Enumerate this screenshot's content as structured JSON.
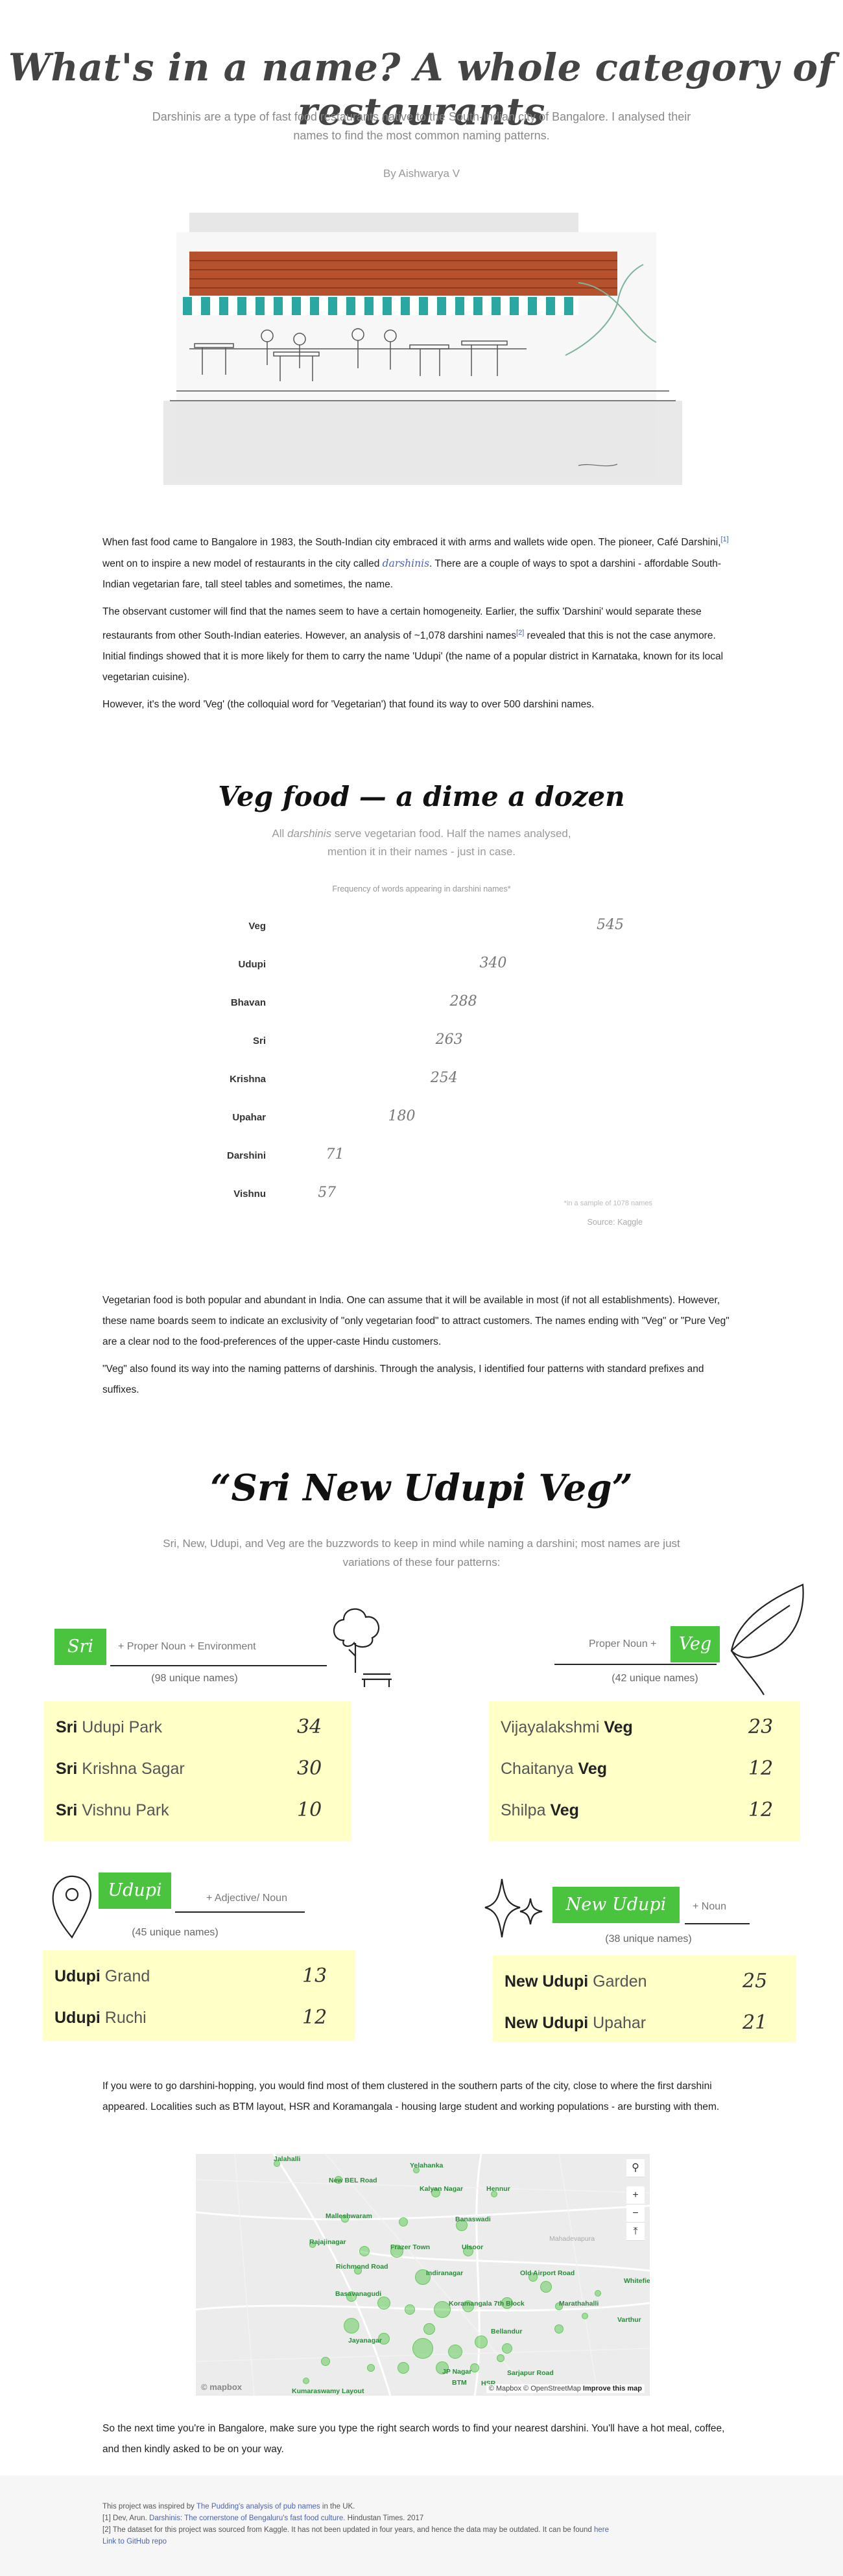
{
  "header": {
    "title": "What's in a name? A whole category of restaurants",
    "subtitle": "Darshinis are a type of fast food restaurants native to the South-Indian city of Bangalore. I analysed their names to find the most common naming patterns.",
    "byline": "By Aishwarya V"
  },
  "intro": {
    "p1_a": "When fast food came to Bangalore in 1983, the South-Indian city embraced it with arms and wallets wide open. The pioneer, Café Darshini,",
    "p1_ref": "[1]",
    "p1_b": " went on to inspire a new model of restaurants in the city called ",
    "p1_link": "darshinis",
    "p1_c": ". There are a couple of ways to spot a darshini - affordable South-Indian vegetarian fare, tall steel tables and sometimes, the name.",
    "p2_a": "The observant customer will find that the names seem to have a certain homogeneity. Earlier, the suffix 'Darshini' would separate these restaurants from other South-Indian eateries. However, an analysis of ~1,078 darshini names",
    "p2_ref": "[2]",
    "p2_b": " revealed that this is not the case anymore. Initial findings showed that it is more likely for them to carry the name 'Udupi' (the name of a popular district in Karnataka, known for its local vegetarian cuisine).",
    "p3": "However, it's the word 'Veg' (the colloquial word for 'Vegetarian') that found its way to over 500 darshini names."
  },
  "section1": {
    "heading": "Veg food — a dime a dozen",
    "sub_a": "All ",
    "sub_em": "darshinis",
    "sub_b": " serve vegetarian food. Half the names analysed, mention it in their names - just in case."
  },
  "chart_data": {
    "type": "bar",
    "title": "Frequency of words appearing in darshini names*",
    "categories": [
      "Veg",
      "Udupi",
      "Bhavan",
      "Sri",
      "Krishna",
      "Upahar",
      "Darshini",
      "Vishnu"
    ],
    "values": [
      545,
      340,
      288,
      263,
      254,
      180,
      71,
      57
    ],
    "note": "*in a sample of 1078 names",
    "source": "Source: Kaggle"
  },
  "middle": {
    "p1": "Vegetarian food is both popular and abundant in India. One can assume that it will be available in most (if not all establishments). However, these name boards seem to indicate an exclusivity of \"only vegetarian food\" to attract customers. The names ending with \"Veg\" or \"Pure Veg\" are a clear nod to the food-preferences of the upper-caste Hindu customers.",
    "p2": "\"Veg\" also found its way into the naming patterns of darshinis. Through the analysis, I identified four patterns with standard prefixes and suffixes."
  },
  "section2": {
    "heading": "“Sri New Udupi Veg”",
    "sub": "Sri, New, Udupi, and Veg are the buzzwords to keep in mind while naming a darshini; most names are just variations of these four patterns:"
  },
  "patterns": {
    "sri": {
      "tag": "Sri",
      "text": "+ Proper Noun + Environment",
      "count": "(98 unique names)",
      "examples": [
        {
          "prefix": "Sri",
          "rest": " Udupi Park",
          "num": "34"
        },
        {
          "prefix": "Sri",
          "rest": " Krishna Sagar",
          "num": "30"
        },
        {
          "prefix": "Sri",
          "rest": " Vishnu Park",
          "num": "10"
        }
      ]
    },
    "veg": {
      "tag": "Veg",
      "text": "Proper Noun +",
      "count": "(42 unique names)",
      "examples": [
        {
          "rest": "Vijayalakshmi ",
          "suffix": "Veg",
          "num": "23"
        },
        {
          "rest": "Chaitanya ",
          "suffix": "Veg",
          "num": "12"
        },
        {
          "rest": "Shilpa ",
          "suffix": "Veg",
          "num": "12"
        }
      ]
    },
    "udupi": {
      "tag": "Udupi",
      "text": "+ Adjective/ Noun",
      "count": "(45 unique names)",
      "examples": [
        {
          "prefix": "Udupi",
          "rest": " Grand",
          "num": "13"
        },
        {
          "prefix": "Udupi",
          "rest": " Ruchi",
          "num": "12"
        }
      ]
    },
    "new_udupi": {
      "tag": "New Udupi",
      "text": "+ Noun",
      "count": "(38 unique names)",
      "examples": [
        {
          "prefix": "New Udupi",
          "rest": " Garden",
          "num": "25"
        },
        {
          "prefix": "New Udupi",
          "rest": " Upahar",
          "num": "21"
        }
      ]
    }
  },
  "hopping": {
    "p1": "If you were to go darshini-hopping, you would find most of them clustered in the southern parts of the city, close to where the first darshini appeared. Localities such as BTM layout, HSR and Koramangala - housing large student and working populations - are bursting with them."
  },
  "map": {
    "places": [
      "Jalahalli",
      "Yelahanka",
      "New BEL Road",
      "Kalyan Nagar",
      "Hennur",
      "Malleshwaram",
      "Banaswadi",
      "Rajajinagar",
      "Frazer Town",
      "Ulsoor",
      "Richmond Road",
      "Indiranagar",
      "Old Airport Road",
      "Whitefield",
      "Basavanagudi",
      "Koramangala 7th Block",
      "Marathahalli",
      "Jayanagar",
      "Bellandur",
      "Varthur",
      "JP Nagar",
      "BTM",
      "HSR",
      "Sarjapur Road",
      "Kumaraswamy Layout",
      "Mahadevapura"
    ],
    "credit_a": "© Mapbox © OpenStreetMap",
    "credit_b": "Improve this map",
    "logo": "© mapbox",
    "zoom_in": "+",
    "zoom_out": "−",
    "search": "⚲",
    "reset": "⤒"
  },
  "closing": {
    "p1": "So the next time you're in Bangalore, make sure you type the right search words to find your nearest darshini. You'll have a hot meal, coffee, and then kindly asked to be on your way."
  },
  "footer": {
    "line1_a": "This project was inspired by ",
    "line1_link": "The Pudding's analysis of pub names",
    "line1_b": " in the UK.",
    "line2_a": "[1] Dev, Arun. ",
    "line2_link": "Darshinis: The cornerstone of Bengaluru's fast food culture.",
    "line2_b": " Hindustan Times. 2017",
    "line3_a": "[2] The dataset for this project was sourced from Kaggle. It has not been updated in four years, and hence the data may be outdated. It can be found ",
    "line3_link": "here",
    "line4_link": "Link to GitHub repo"
  },
  "colors": {
    "accent_green": "#4ac33e",
    "highlight_yellow": "#ffffc8",
    "link_blue": "#4a63b8",
    "awning_red": "#b5512d",
    "awning_teal": "#2aa7a0"
  }
}
